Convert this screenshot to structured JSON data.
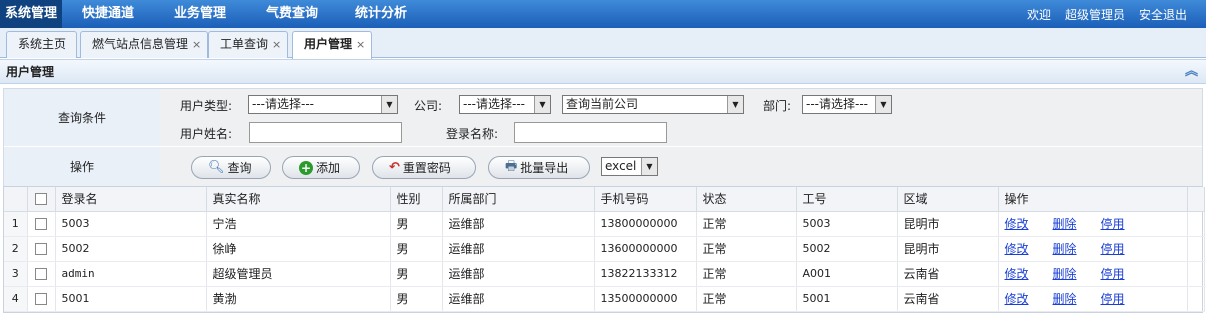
{
  "nav": {
    "items": [
      "系统管理",
      "快捷通道",
      "业务管理",
      "气费查询",
      "统计分析"
    ],
    "welcome": "欢迎",
    "user": "超级管理员",
    "logout": "安全退出"
  },
  "tabs": [
    {
      "label": "系统主页"
    },
    {
      "label": "燃气站点信息管理",
      "close": "×"
    },
    {
      "label": "工单查询",
      "close": "×"
    },
    {
      "label": "用户管理",
      "close": "×"
    }
  ],
  "panel": {
    "title": "用户管理",
    "collapse_icon": "double-chevron-up-icon"
  },
  "query": {
    "label": "查询条件",
    "user_type_label": "用户类型:",
    "user_type_value": "---请选择---",
    "company_label": "公司:",
    "company_value": "---请选择---",
    "company_scope_value": "查询当前公司",
    "dept_label": "部门:",
    "dept_value": "---请选择---",
    "user_name_label": "用户姓名:",
    "user_name_value": "",
    "login_name_label": "登录名称:",
    "login_name_value": ""
  },
  "ops": {
    "label": "操作",
    "query_btn": "查询",
    "add_btn": "添加",
    "reset_pwd_btn": "重置密码",
    "export_btn": "批量导出",
    "export_format": "excel"
  },
  "table": {
    "columns": [
      "登录名",
      "真实名称",
      "性别",
      "所属部门",
      "手机号码",
      "状态",
      "工号",
      "区域",
      "操作"
    ],
    "row_actions": [
      "修改",
      "删除",
      "停用"
    ],
    "rows": [
      {
        "n": "1",
        "login": "5003",
        "real": "宁浩",
        "sex": "男",
        "dept": "运维部",
        "phone": "13800000000",
        "status": "正常",
        "no": "5003",
        "area": "昆明市"
      },
      {
        "n": "2",
        "login": "5002",
        "real": "徐峥",
        "sex": "男",
        "dept": "运维部",
        "phone": "13600000000",
        "status": "正常",
        "no": "5002",
        "area": "昆明市"
      },
      {
        "n": "3",
        "login": "admin",
        "real": "超级管理员",
        "sex": "男",
        "dept": "运维部",
        "phone": "13822133312",
        "status": "正常",
        "no": "A001",
        "area": "云南省"
      },
      {
        "n": "4",
        "login": "5001",
        "real": "黄渤",
        "sex": "男",
        "dept": "运维部",
        "phone": "13500000000",
        "status": "正常",
        "no": "5001",
        "area": "云南省"
      }
    ]
  }
}
